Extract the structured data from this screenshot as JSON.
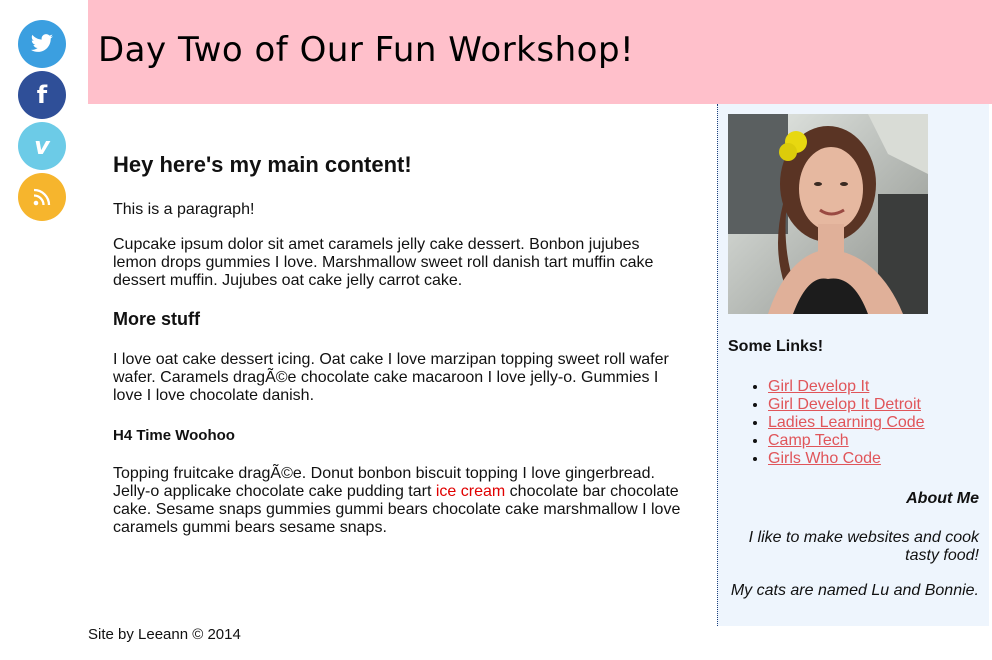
{
  "social": [
    {
      "name": "twitter",
      "icon": "twitter-icon",
      "color": "#3b9fe0"
    },
    {
      "name": "facebook",
      "icon": "facebook-icon",
      "color": "#2f4f98"
    },
    {
      "name": "vimeo",
      "icon": "vimeo-icon",
      "color": "#6ccbe7"
    },
    {
      "name": "rss",
      "icon": "rss-icon",
      "color": "#f6b52d"
    }
  ],
  "header": {
    "title": "Day Two of Our Fun Workshop!",
    "background": "#ffc0cb"
  },
  "main": {
    "heading": "Hey here's my main content!",
    "intro": "This is a paragraph!",
    "cupcake": "Cupcake ipsum dolor sit amet caramels jelly cake dessert. Bonbon jujubes lemon drops gummies I love. Marshmallow sweet roll danish tart muffin cake dessert muffin. Jujubes oat cake jelly carrot cake.",
    "more_heading": "More stuff",
    "more_text": "I love oat cake dessert icing. Oat cake I love marzipan topping sweet roll wafer wafer. Caramels dragÃ©e chocolate cake macaroon I love jelly-o. Gummies I love I love chocolate danish.",
    "h4_heading": "H4 Time Woohoo",
    "final_before": "Topping fruitcake dragÃ©e. Donut bonbon biscuit topping I love gingerbread. Jelly-o applicake chocolate cake pudding tart ",
    "final_highlight": "ice cream",
    "final_after": " chocolate bar chocolate cake. Sesame snaps gummies gummi bears chocolate cake marshmallow I love caramels gummi bears sesame snaps."
  },
  "sidebar": {
    "links_heading": "Some Links!",
    "links": [
      "Girl Develop It",
      "Girl Develop It Detroit",
      "Ladies Learning Code",
      "Camp Tech",
      "Girls Who Code"
    ],
    "about_heading": "About Me",
    "about_text_1": "I like to make websites and cook tasty food!",
    "about_text_2": "My cats are named Lu and Bonnie."
  },
  "footer": {
    "text": "Site by Leeann © 2014"
  },
  "colors": {
    "sidebar_bg": "#eef5fd",
    "link": "#e0555a",
    "highlight": "#e00000"
  }
}
